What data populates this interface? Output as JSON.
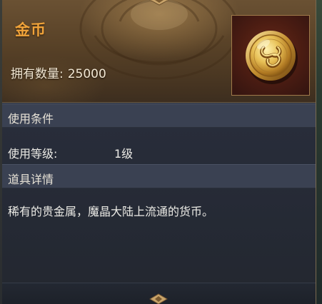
{
  "item": {
    "name": "金币",
    "owned_label": "拥有数量:",
    "owned_value": "25000",
    "icon": "gold-coin-icon"
  },
  "usage": {
    "title": "使用条件",
    "level_label": "使用等级:",
    "level_value": "1级"
  },
  "details": {
    "title": "道具详情",
    "description": "稀有的贵金属，魔晶大陆上流通的货币。"
  },
  "colors": {
    "name": "#f0a33a",
    "header_bg": "#5a4328",
    "panel_bg": "#262b37",
    "section_bg": "#3a4152",
    "frame_border": "#a07a4a"
  }
}
